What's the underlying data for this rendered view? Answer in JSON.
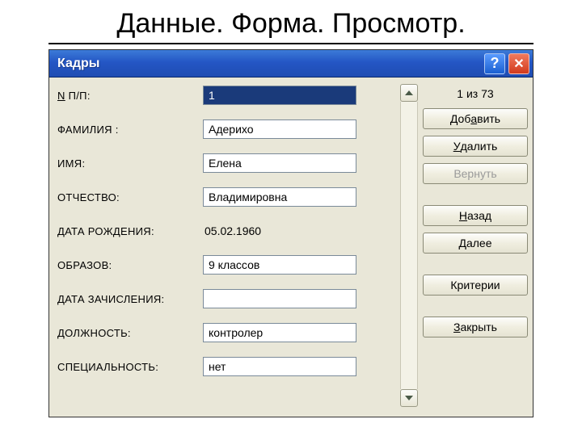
{
  "page_title": "Данные. Форма. Просмотр.",
  "window": {
    "title": "Кадры",
    "help_symbol": "?",
    "close_symbol": "✕"
  },
  "fields": {
    "n_pp": {
      "label": "N П/П:",
      "value": "1",
      "type": "input",
      "selected": true
    },
    "lastname": {
      "label": "ФАМИЛИЯ    :",
      "value": "Адерихо",
      "type": "input"
    },
    "firstname": {
      "label": "ИМЯ:",
      "value": "Елена",
      "type": "input"
    },
    "patronymic": {
      "label": "ОТЧЕСТВО:",
      "value": "Владимировна",
      "type": "input"
    },
    "birthdate": {
      "label": "ДАТА РОЖДЕНИЯ:",
      "value": "05.02.1960",
      "type": "static"
    },
    "education": {
      "label": "ОБРАЗОВ:",
      "value": "9 классов",
      "type": "input"
    },
    "hiredate": {
      "label": "ДАТА ЗАЧИСЛЕНИЯ:",
      "value": "",
      "type": "input"
    },
    "position": {
      "label": "ДОЛЖНОСТЬ:",
      "value": "контролер",
      "type": "input"
    },
    "specialty": {
      "label": "СПЕЦИАЛЬНОСТЬ:",
      "value": "нет",
      "type": "input"
    }
  },
  "counter": "1 из 73",
  "buttons": {
    "add": "Добавить",
    "delete": "Удалить",
    "restore": "Вернуть",
    "back": "Назад",
    "next": "Далее",
    "criteria": "Критерии",
    "close": "Закрыть"
  },
  "mnemonics": {
    "n_pp": "N",
    "add": "а",
    "delete": "У",
    "back": "Н",
    "next": "Д",
    "close": "З"
  }
}
